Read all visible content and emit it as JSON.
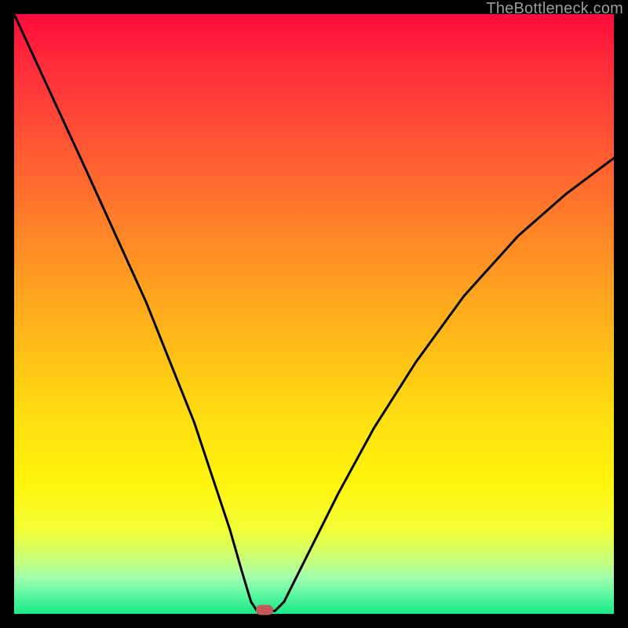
{
  "watermark": "TheBottleneck.com",
  "marker": {
    "x_frac": 0.418,
    "y_frac": 0.993
  },
  "chart_data": {
    "type": "line",
    "title": "",
    "xlabel": "",
    "ylabel": "",
    "xlim": [
      0,
      100
    ],
    "ylim": [
      0,
      100
    ],
    "series": [
      {
        "name": "curve",
        "x": [
          0,
          6,
          12,
          17,
          22,
          26,
          30,
          33,
          36,
          38,
          39.5,
          40.5,
          41.8,
          43.5,
          45,
          49,
          54,
          60,
          67,
          75,
          84,
          92,
          100
        ],
        "y": [
          100,
          87,
          74,
          63,
          52,
          42,
          32,
          23,
          14,
          7,
          2,
          0.5,
          0.5,
          0.5,
          2,
          10,
          20,
          31,
          42,
          53,
          63,
          70,
          76
        ]
      }
    ],
    "background_gradient": {
      "type": "vertical",
      "stops": [
        {
          "pos": 0.0,
          "color": "#ff0a3c"
        },
        {
          "pos": 0.08,
          "color": "#ff2b3a"
        },
        {
          "pos": 0.18,
          "color": "#ff4a36"
        },
        {
          "pos": 0.28,
          "color": "#ff6a2e"
        },
        {
          "pos": 0.38,
          "color": "#ff8a26"
        },
        {
          "pos": 0.48,
          "color": "#ffa81e"
        },
        {
          "pos": 0.58,
          "color": "#ffc416"
        },
        {
          "pos": 0.68,
          "color": "#ffe010"
        },
        {
          "pos": 0.78,
          "color": "#fff40c"
        },
        {
          "pos": 0.86,
          "color": "#f2ff35"
        },
        {
          "pos": 0.91,
          "color": "#c8ff7a"
        },
        {
          "pos": 0.94,
          "color": "#a0ffb0"
        },
        {
          "pos": 0.97,
          "color": "#57f7a0"
        },
        {
          "pos": 1.0,
          "color": "#18e886"
        }
      ]
    }
  }
}
